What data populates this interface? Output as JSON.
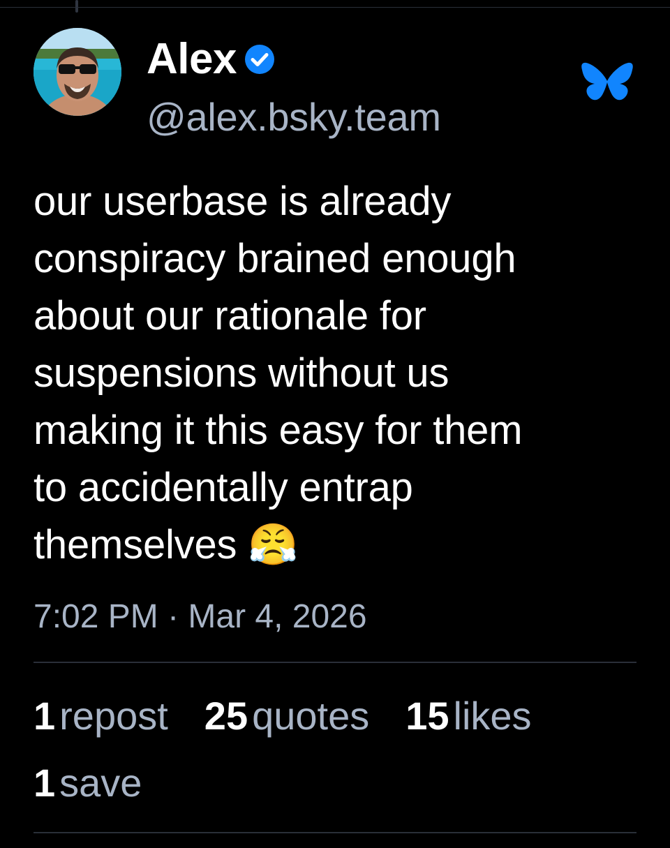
{
  "colors": {
    "background": "#000000",
    "text_primary": "#ffffff",
    "text_secondary": "#a8b4c6",
    "accent": "#1185fe",
    "divider": "#2a2f38"
  },
  "author": {
    "display_name": "Alex",
    "handle": "@alex.bsky.team",
    "verified": true,
    "avatar_icon": "avatar-photo",
    "verified_icon": "verified-check-icon"
  },
  "app": {
    "logo_icon": "bluesky-butterfly-icon"
  },
  "post": {
    "text": "our userbase is already\nconspiracy brained enough\nabout our rationale for\nsuspensions without us\nmaking it this easy for them\nto accidentally entrap\nthemselves 😤",
    "timestamp": "7:02 PM · Mar 4, 2026"
  },
  "stats": {
    "reposts": {
      "count": "1",
      "label": "repost"
    },
    "quotes": {
      "count": "25",
      "label": "quotes"
    },
    "likes": {
      "count": "15",
      "label": "likes"
    },
    "saves": {
      "count": "1",
      "label": "save"
    }
  }
}
